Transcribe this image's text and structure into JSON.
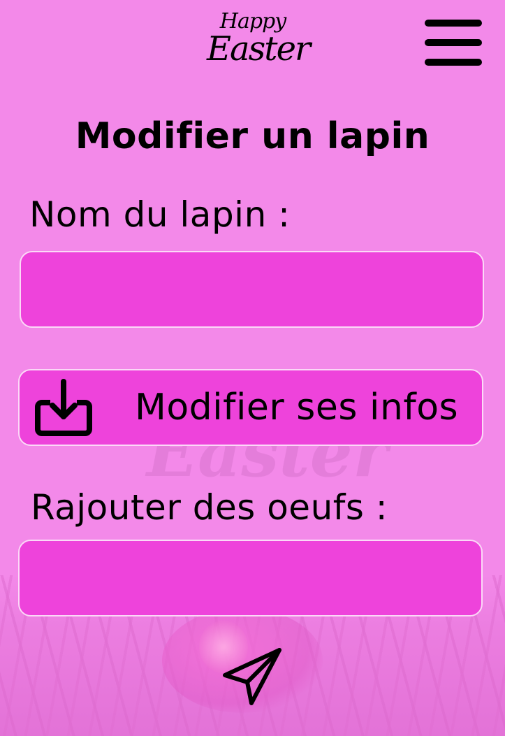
{
  "header": {
    "logo": {
      "line1": "Happy",
      "line2": "Easter"
    },
    "menu_icon": "hamburger-menu-icon"
  },
  "page": {
    "title": "Modifier un lapin"
  },
  "form": {
    "name_label": "Nom du lapin :",
    "name_value": "",
    "modify_button_label": "Modifier ses infos",
    "modify_button_icon": "download-icon",
    "eggs_label": "Rajouter des oeufs :",
    "eggs_value": "",
    "send_icon": "paper-plane-icon"
  },
  "colors": {
    "background": "#f389e9",
    "field": "#ee43db",
    "field_border": "#fbd9f7"
  }
}
